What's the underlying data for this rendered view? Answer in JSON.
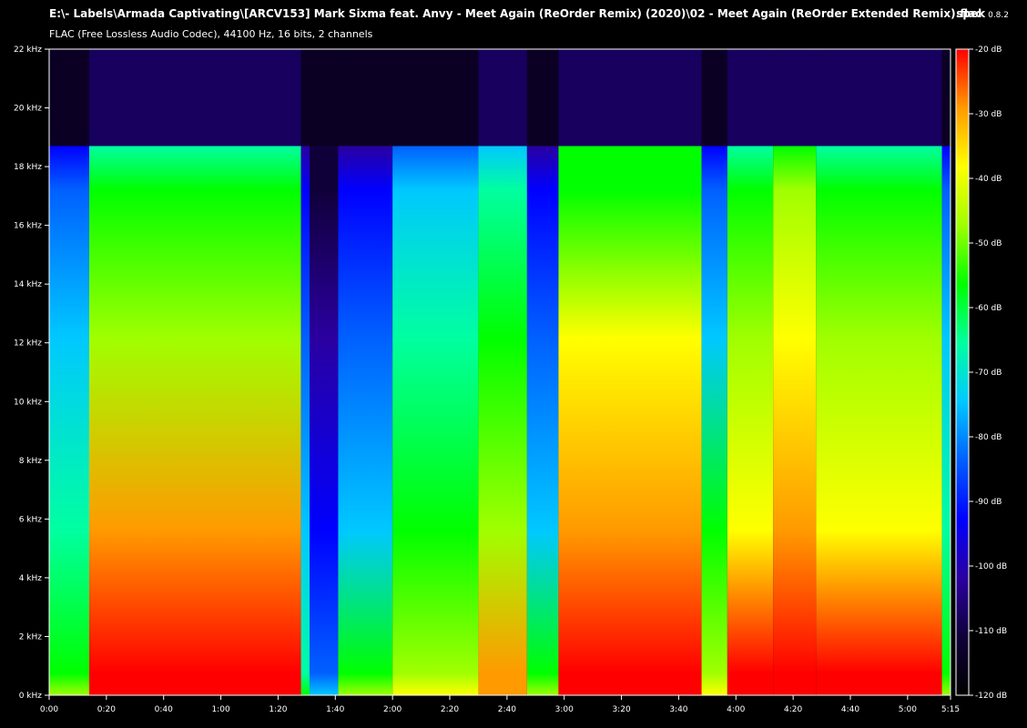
{
  "header": {
    "title": "E:\\- Labels\\Armada Captivating\\[ARCV153] Mark Sixma feat. Anvy - Meet Again (ReOrder Remix) (2020)\\02 - Meet Again (ReOrder Extended Remix).flac",
    "subtitle": "FLAC (Free Lossless Audio Codec), 44100 Hz, 16 bits, 2 channels",
    "app_name": "spek",
    "app_version": "0.8.2"
  },
  "chart_data": {
    "type": "heatmap",
    "title": "E:\\- Labels\\Armada Captivating\\[ARCV153] Mark Sixma feat. Anvy - Meet Again (ReOrder Remix) (2020)\\02 - Meet Again (ReOrder Extended Remix).flac",
    "x_axis": {
      "unit": "time",
      "range_seconds": [
        0,
        315
      ],
      "tick_labels": [
        "0:00",
        "0:20",
        "0:40",
        "1:00",
        "1:20",
        "1:40",
        "2:00",
        "2:20",
        "2:40",
        "3:00",
        "3:20",
        "3:40",
        "4:00",
        "4:20",
        "4:40",
        "5:00",
        "5:15"
      ],
      "tick_seconds": [
        0,
        20,
        40,
        60,
        80,
        100,
        120,
        140,
        160,
        180,
        200,
        220,
        240,
        260,
        280,
        300,
        315
      ]
    },
    "y_axis": {
      "unit": "kHz",
      "range": [
        0,
        22
      ],
      "tick_labels": [
        "0 kHz",
        "2 kHz",
        "4 kHz",
        "6 kHz",
        "8 kHz",
        "10 kHz",
        "12 kHz",
        "14 kHz",
        "16 kHz",
        "18 kHz",
        "20 kHz",
        "22 kHz"
      ],
      "tick_values": [
        0,
        2,
        4,
        6,
        8,
        10,
        12,
        14,
        16,
        18,
        20,
        22
      ]
    },
    "color_scale": {
      "unit": "dB",
      "range": [
        -120,
        -20
      ],
      "tick_labels": [
        "-20 dB",
        "-30 dB",
        "-40 dB",
        "-50 dB",
        "-60 dB",
        "-70 dB",
        "-80 dB",
        "-90 dB",
        "-100 dB",
        "-110 dB",
        "-120 dB"
      ],
      "tick_values": [
        -20,
        -30,
        -40,
        -50,
        -60,
        -70,
        -80,
        -90,
        -100,
        -110,
        -120
      ],
      "colors": [
        "#000000",
        "#10003a",
        "#2a00a0",
        "#0000ff",
        "#0060ff",
        "#00c8ff",
        "#00ffa0",
        "#00ff00",
        "#a0ff00",
        "#ffff00",
        "#ff9a00",
        "#ff0000"
      ]
    },
    "spectrum": {
      "lowpass_cutoff_khz": 18.7,
      "segments": [
        {
          "start": 0,
          "end": 14,
          "energy": 0.5
        },
        {
          "start": 14,
          "end": 88,
          "energy": 0.82
        },
        {
          "start": 88,
          "end": 91,
          "energy": 0.42
        },
        {
          "start": 91,
          "end": 101,
          "energy": 0.22
        },
        {
          "start": 101,
          "end": 120,
          "energy": 0.45
        },
        {
          "start": 120,
          "end": 150,
          "energy": 0.6
        },
        {
          "start": 150,
          "end": 167,
          "energy": 0.7
        },
        {
          "start": 167,
          "end": 178,
          "energy": 0.45
        },
        {
          "start": 178,
          "end": 228,
          "energy": 0.85
        },
        {
          "start": 228,
          "end": 237,
          "energy": 0.55
        },
        {
          "start": 237,
          "end": 253,
          "energy": 0.8
        },
        {
          "start": 253,
          "end": 268,
          "energy": 0.88
        },
        {
          "start": 268,
          "end": 312,
          "energy": 0.8
        },
        {
          "start": 312,
          "end": 315,
          "energy": 0.5
        }
      ]
    }
  }
}
